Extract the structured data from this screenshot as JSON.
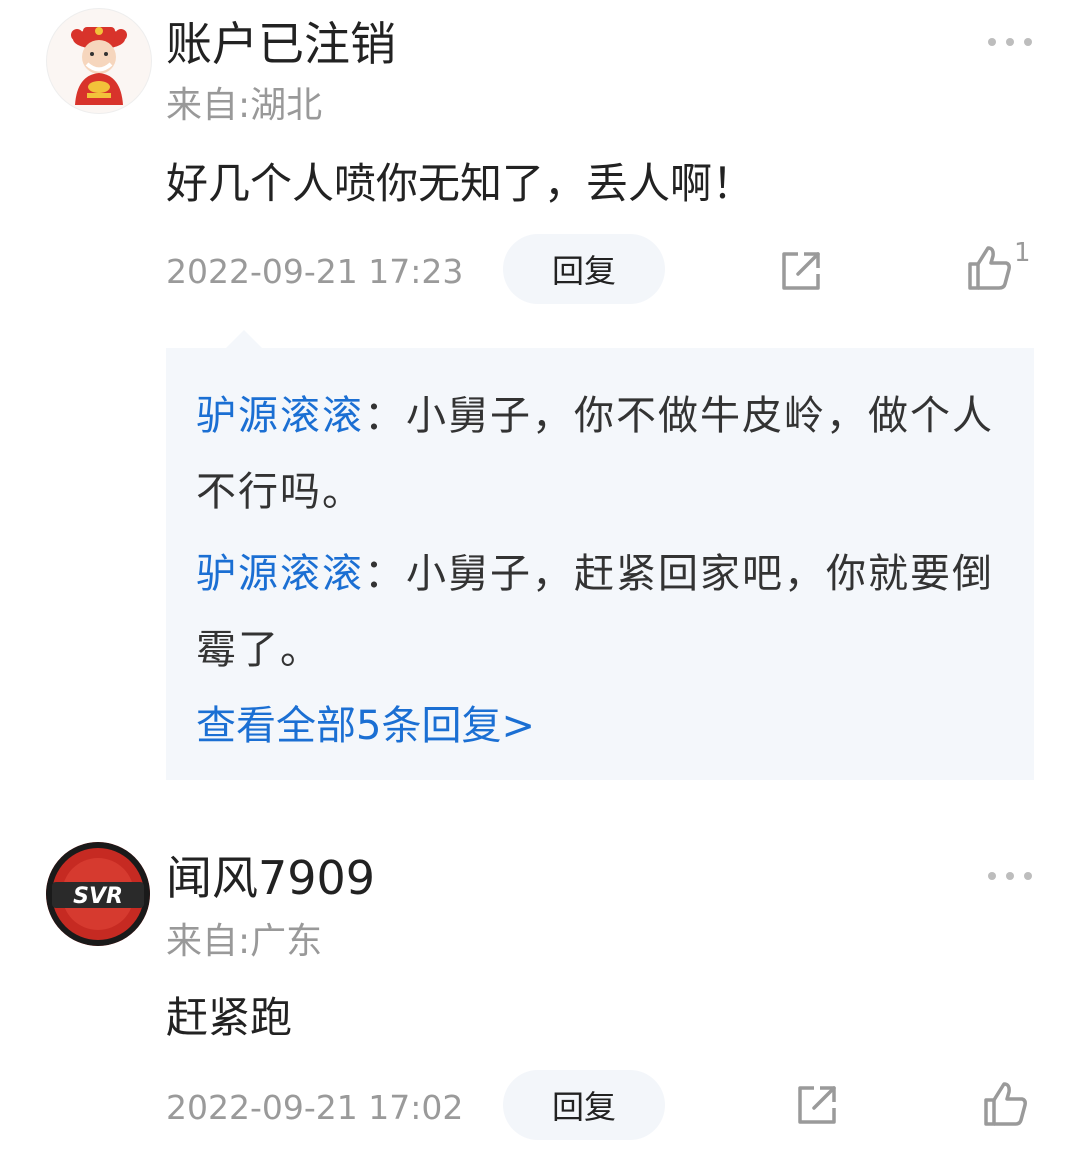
{
  "comments": [
    {
      "username": "账户已注销",
      "location": "来自:湖北",
      "text": "好几个人喷你无知了，丢人啊！",
      "time": "2022-09-21 17:23",
      "reply_label": "回复",
      "like_count": "1",
      "sub_replies": [
        {
          "author": "驴源滚滚",
          "sep": "：",
          "text": "小舅子，你不做牛皮岭，做个人不行吗。"
        },
        {
          "author": "驴源滚滚",
          "sep": "：",
          "text": "小舅子，赶紧回家吧，你就要倒霉了。"
        }
      ],
      "view_all": "查看全部5条回复>"
    },
    {
      "username": "闻风7909",
      "location": "来自:广东",
      "text": "赶紧跑",
      "time": "2022-09-21 17:02",
      "reply_label": "回复",
      "avatar_text": "SVR"
    }
  ],
  "icons": {
    "more": "more-dots-icon",
    "share": "share-external-icon",
    "like": "thumbs-up-icon"
  },
  "colors": {
    "link_blue": "#1b6fd3",
    "muted_gray": "#9a9a9a",
    "reply_box_bg": "#f4f7fb",
    "reply_button_bg": "#f3f6fa"
  }
}
